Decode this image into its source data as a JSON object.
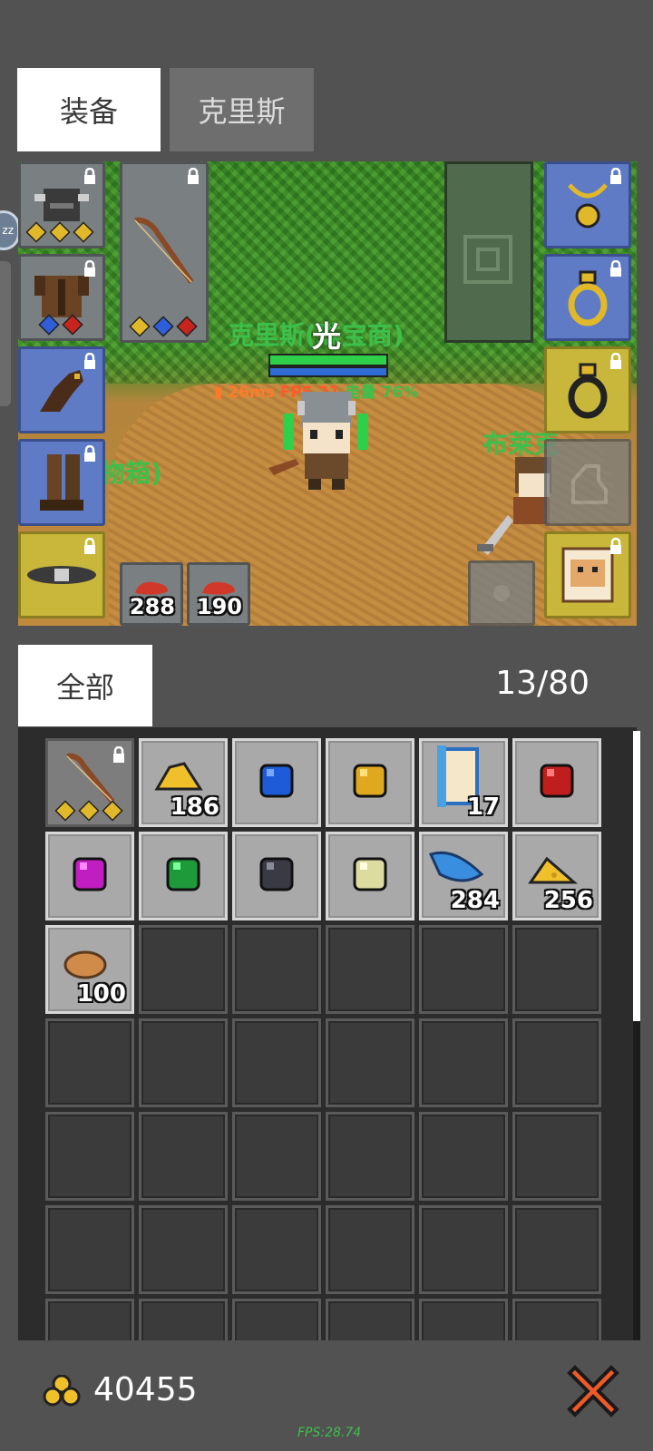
{
  "tabs": {
    "equipment": "装备",
    "character": "克里斯"
  },
  "scene": {
    "player_name": "克里斯(珠宝商)",
    "overhead_char": "光",
    "status": {
      "ping": "26ms",
      "fps": "FPS 21",
      "battery": "电量 76%"
    },
    "npc_name": "布莱克",
    "chest_label": "物箱)",
    "consumables": [
      {
        "qty": "288"
      },
      {
        "qty": "190"
      }
    ],
    "edge_badge": "zz"
  },
  "bag": {
    "tab_all": "全部",
    "count": "13/80"
  },
  "items": [
    {
      "name": "bow-icon",
      "qty": "",
      "locked": true
    },
    {
      "name": "gold-ore-icon",
      "qty": "186"
    },
    {
      "name": "blue-gem-icon",
      "qty": ""
    },
    {
      "name": "yellow-gem-icon",
      "qty": ""
    },
    {
      "name": "scroll-icon",
      "qty": "17"
    },
    {
      "name": "red-gem-icon",
      "qty": ""
    },
    {
      "name": "purple-gem-icon",
      "qty": ""
    },
    {
      "name": "green-gem-icon",
      "qty": ""
    },
    {
      "name": "black-gem-icon",
      "qty": ""
    },
    {
      "name": "pale-gem-icon",
      "qty": ""
    },
    {
      "name": "blue-feather-icon",
      "qty": "284"
    },
    {
      "name": "cheese-icon",
      "qty": "256"
    },
    {
      "name": "bread-icon",
      "qty": "100"
    }
  ],
  "footer": {
    "gold": "40455",
    "fps": "FPS:28.74"
  },
  "colors": {
    "accent_green": "#3cc04b",
    "status_orange": "#ff7a2a",
    "close_red": "#f05a28"
  }
}
